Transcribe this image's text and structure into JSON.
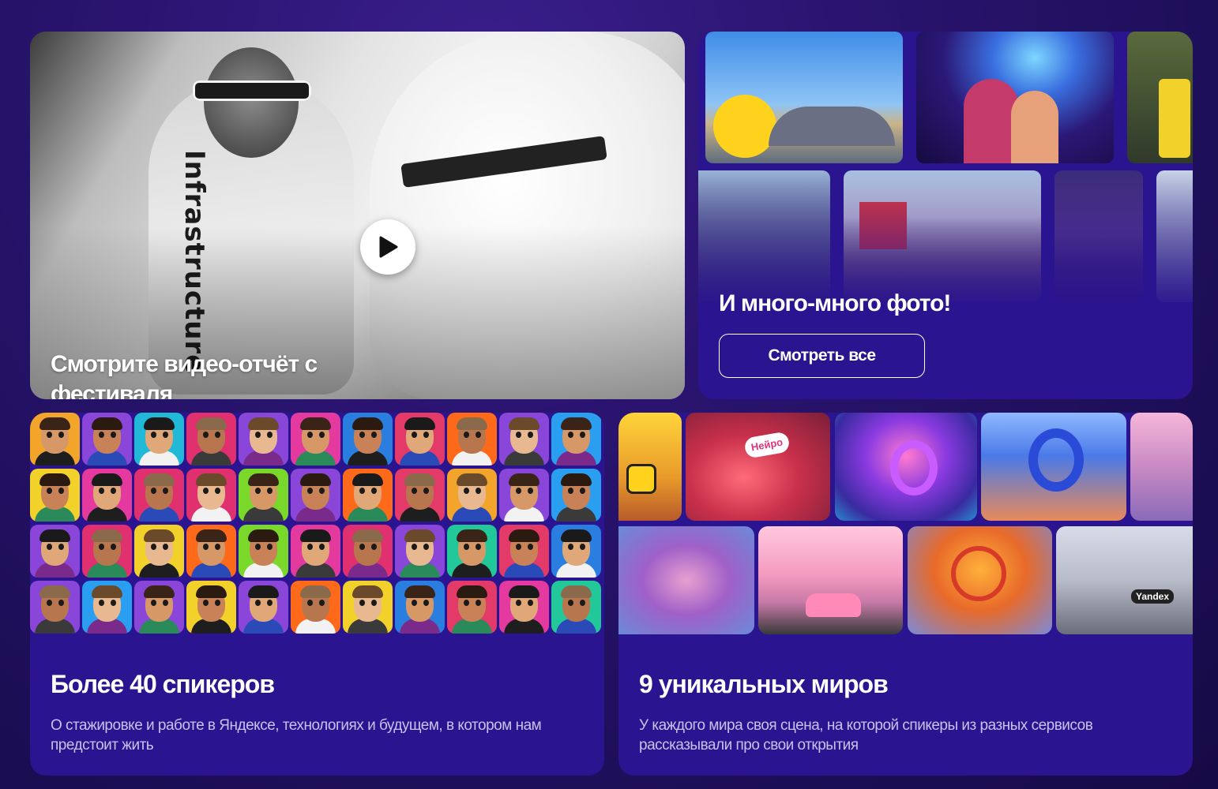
{
  "video": {
    "title": "Смотрите видео-отчёт с фестиваля",
    "side_text": "Infrastructure"
  },
  "photos": {
    "title": "И много-много фото!",
    "button_label": "Смотреть все"
  },
  "speakers": {
    "title": "Более 40 спикеров",
    "description": "О стажировке и работе в Яндексе, технологиях и будущем, в котором нам предстоит жить",
    "avatar_backgrounds": [
      [
        "#f2a52a",
        "#8a46d8",
        "#22b8d8",
        "#e0306f",
        "#8a46d8",
        "#e43aa0",
        "#2a7ee0",
        "#e43a6a",
        "#ff6a1a",
        "#8a46d8",
        "#2a9ef0"
      ],
      [
        "#f2d22a",
        "#e43aa0",
        "#e0306f",
        "#e0306f",
        "#7ad82a",
        "#8a46d8",
        "#ff6a1a",
        "#e43a6a",
        "#f2a52a",
        "#8a46d8",
        "#2a9ef0"
      ],
      [
        "#8a46d8",
        "#e0306f",
        "#f2d22a",
        "#ff6a1a",
        "#7ad82a",
        "#e43aa0",
        "#e0306f",
        "#8a46d8",
        "#22c89a",
        "#e43a6a",
        "#2a7ee0"
      ],
      [
        "#8a46d8",
        "#2a9ef0",
        "#8a46d8",
        "#f2d22a",
        "#8a46d8",
        "#ff6a1a",
        "#f2d22a",
        "#2a7ee0",
        "#e43a6a",
        "#e43aa0",
        "#22c89a"
      ]
    ]
  },
  "worlds": {
    "title": "9 уникальных миров",
    "description": "У каждого мира своя сцена, на которой спикеры из разных сервисов рассказывали про свои открытия",
    "neuro_label": "Нейро",
    "yandex_label": "Yandex"
  }
}
